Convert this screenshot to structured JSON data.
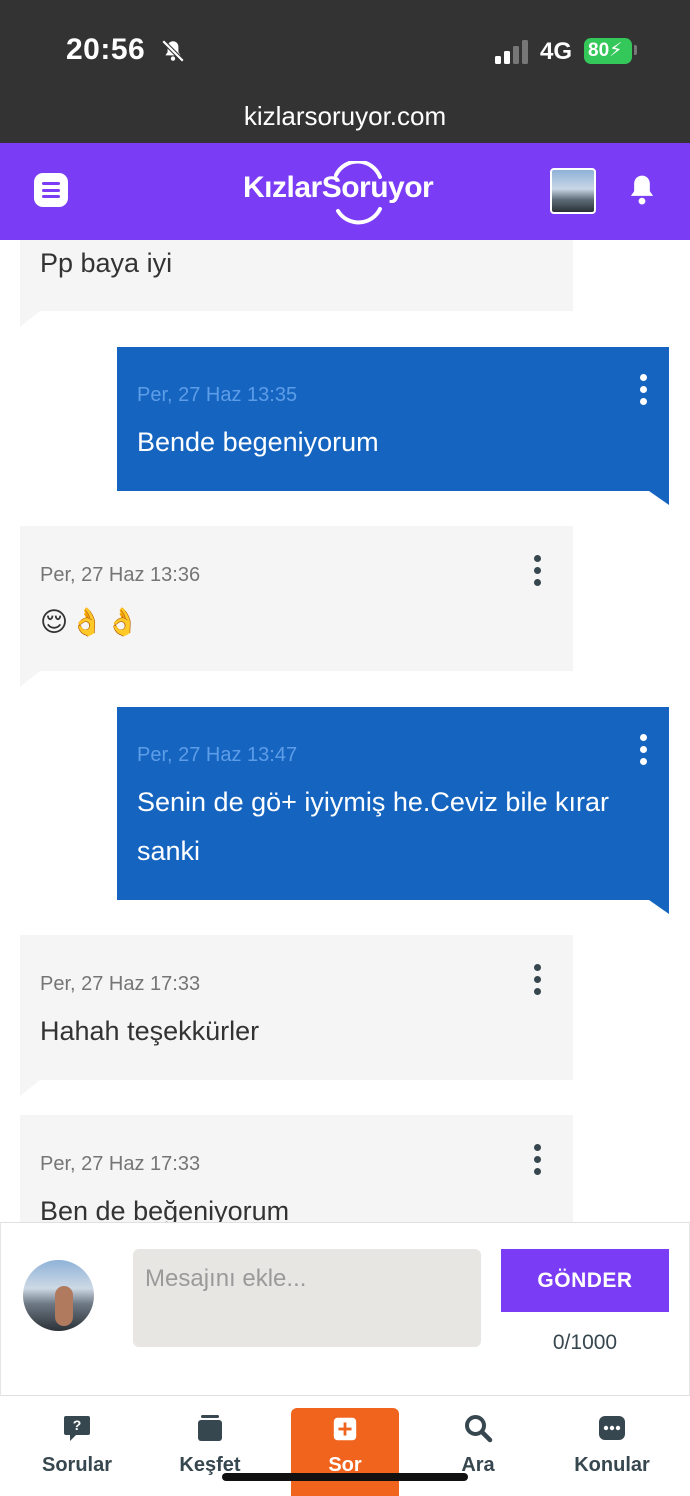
{
  "status_bar": {
    "time": "20:56",
    "network": "4G",
    "battery": "80",
    "icons": [
      "bell-slash-icon",
      "signal-icon",
      "battery-charging-icon"
    ]
  },
  "browser": {
    "url": "kizlarsoruyor.com"
  },
  "header": {
    "logo": "KızlarSoruyor",
    "brand_color": "#7a3cf5",
    "icons": [
      "menu-icon",
      "user-avatar",
      "bell-icon"
    ]
  },
  "messages": [
    {
      "direction": "incoming",
      "time": "",
      "text": "Pp baya iyi"
    },
    {
      "direction": "outgoing",
      "time": "Per, 27 Haz 13:35",
      "text": "Bende begeniyorum"
    },
    {
      "direction": "incoming",
      "time": "Per, 27 Haz 13:36",
      "text": "😌👌👌"
    },
    {
      "direction": "outgoing",
      "time": "Per, 27 Haz 13:47",
      "text": "Senin de gö+ iyiymiş he.Ceviz bile kırar sanki"
    },
    {
      "direction": "incoming",
      "time": "Per, 27 Haz 17:33",
      "text": "Hahah teşekkürler"
    },
    {
      "direction": "incoming",
      "time": "Per, 27 Haz 17:33",
      "text": "Ben de beğeniyorum"
    }
  ],
  "colors": {
    "outgoing_bubble": "#1565c0",
    "incoming_bubble": "#f5f5f5",
    "sor_button": "#f0641e"
  },
  "composer": {
    "placeholder": "Mesajını ekle...",
    "send_label": "GÖNDER",
    "counter": "0/1000"
  },
  "bottom_nav": [
    {
      "label": "Sorular",
      "icon": "question-bubble-icon"
    },
    {
      "label": "Keşfet",
      "icon": "cards-icon"
    },
    {
      "label": "Sor",
      "icon": "plus-square-icon"
    },
    {
      "label": "Ara",
      "icon": "search-icon"
    },
    {
      "label": "Konular",
      "icon": "dots-bubble-icon"
    }
  ]
}
